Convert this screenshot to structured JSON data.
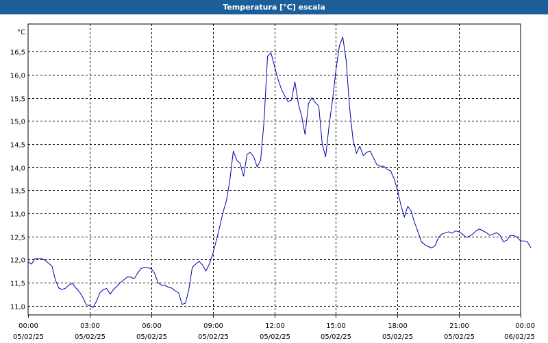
{
  "window": {
    "title": "Temperatura [°C] escala"
  },
  "chart_data": {
    "type": "line",
    "title": "Temperatura [°C] escala",
    "y_unit": "°C",
    "ylim": [
      10.8,
      17.1
    ],
    "y_ticks": [
      11.0,
      11.5,
      12.0,
      12.5,
      13.0,
      13.5,
      14.0,
      14.5,
      15.0,
      15.5,
      16.0,
      16.5
    ],
    "y_tick_labels": [
      "11,0",
      "11,5",
      "12,0",
      "12,5",
      "13,0",
      "13,5",
      "14,0",
      "14,5",
      "15,0",
      "15,5",
      "16,0",
      "16,5"
    ],
    "xlim": [
      "2025-02-05 00:00",
      "2025-02-06 00:00"
    ],
    "x_ticks": [
      {
        "time": "00:00",
        "date": "05/02/25"
      },
      {
        "time": "03:00",
        "date": "05/02/25"
      },
      {
        "time": "06:00",
        "date": "05/02/25"
      },
      {
        "time": "09:00",
        "date": "05/02/25"
      },
      {
        "time": "12:00",
        "date": "05/02/25"
      },
      {
        "time": "15:00",
        "date": "05/02/25"
      },
      {
        "time": "18:00",
        "date": "05/02/25"
      },
      {
        "time": "21:00",
        "date": "05/02/25"
      },
      {
        "time": "00:00",
        "date": "06/02/25"
      }
    ],
    "grid": true,
    "line_color": "#0000aa",
    "series": [
      {
        "points": [
          [
            "00:00",
            11.95
          ],
          [
            "00:10",
            11.9
          ],
          [
            "00:20",
            12.02
          ],
          [
            "00:40",
            12.02
          ],
          [
            "00:50",
            11.98
          ],
          [
            "01:00",
            11.92
          ],
          [
            "01:10",
            11.85
          ],
          [
            "01:20",
            11.55
          ],
          [
            "01:30",
            11.38
          ],
          [
            "01:40",
            11.35
          ],
          [
            "01:50",
            11.38
          ],
          [
            "02:00",
            11.45
          ],
          [
            "02:10",
            11.48
          ],
          [
            "02:20",
            11.38
          ],
          [
            "02:30",
            11.3
          ],
          [
            "02:40",
            11.18
          ],
          [
            "02:50",
            11.02
          ],
          [
            "03:00",
            11.0
          ],
          [
            "03:10",
            10.96
          ],
          [
            "03:20",
            11.1
          ],
          [
            "03:30",
            11.28
          ],
          [
            "03:40",
            11.35
          ],
          [
            "03:50",
            11.37
          ],
          [
            "04:00",
            11.25
          ],
          [
            "04:10",
            11.35
          ],
          [
            "04:20",
            11.42
          ],
          [
            "04:30",
            11.5
          ],
          [
            "04:40",
            11.56
          ],
          [
            "04:50",
            11.62
          ],
          [
            "05:00",
            11.62
          ],
          [
            "05:10",
            11.58
          ],
          [
            "05:20",
            11.7
          ],
          [
            "05:30",
            11.8
          ],
          [
            "05:40",
            11.83
          ],
          [
            "05:50",
            11.82
          ],
          [
            "06:00",
            11.8
          ],
          [
            "06:10",
            11.7
          ],
          [
            "06:20",
            11.5
          ],
          [
            "06:30",
            11.44
          ],
          [
            "06:40",
            11.44
          ],
          [
            "06:50",
            11.4
          ],
          [
            "07:00",
            11.38
          ],
          [
            "07:10",
            11.32
          ],
          [
            "07:20",
            11.28
          ],
          [
            "07:30",
            11.03
          ],
          [
            "07:40",
            11.05
          ],
          [
            "07:50",
            11.35
          ],
          [
            "08:00",
            11.83
          ],
          [
            "08:10",
            11.9
          ],
          [
            "08:20",
            11.96
          ],
          [
            "08:30",
            11.88
          ],
          [
            "08:40",
            11.75
          ],
          [
            "08:50",
            11.9
          ],
          [
            "09:00",
            12.12
          ],
          [
            "09:10",
            12.4
          ],
          [
            "09:20",
            12.7
          ],
          [
            "09:30",
            13.02
          ],
          [
            "09:40",
            13.28
          ],
          [
            "09:50",
            13.72
          ],
          [
            "10:00",
            14.35
          ],
          [
            "10:10",
            14.15
          ],
          [
            "10:20",
            14.08
          ],
          [
            "10:30",
            13.8
          ],
          [
            "10:40",
            14.28
          ],
          [
            "10:50",
            14.32
          ],
          [
            "11:00",
            14.22
          ],
          [
            "11:10",
            14.0
          ],
          [
            "11:20",
            14.15
          ],
          [
            "11:30",
            15.0
          ],
          [
            "11:40",
            16.4
          ],
          [
            "11:50",
            16.48
          ],
          [
            "12:00",
            16.2
          ],
          [
            "12:10",
            15.92
          ],
          [
            "12:20",
            15.7
          ],
          [
            "12:30",
            15.55
          ],
          [
            "12:40",
            15.42
          ],
          [
            "12:50",
            15.45
          ],
          [
            "13:00",
            15.85
          ],
          [
            "13:10",
            15.38
          ],
          [
            "13:20",
            15.1
          ],
          [
            "13:30",
            14.7
          ],
          [
            "13:40",
            15.38
          ],
          [
            "13:50",
            15.5
          ],
          [
            "14:00",
            15.4
          ],
          [
            "14:10",
            15.32
          ],
          [
            "14:20",
            14.5
          ],
          [
            "14:30",
            14.22
          ],
          [
            "14:40",
            14.9
          ],
          [
            "14:50",
            15.45
          ],
          [
            "15:00",
            16.1
          ],
          [
            "15:10",
            16.62
          ],
          [
            "15:20",
            16.82
          ],
          [
            "15:30",
            16.3
          ],
          [
            "15:40",
            15.3
          ],
          [
            "15:50",
            14.6
          ],
          [
            "16:00",
            14.3
          ],
          [
            "16:10",
            14.45
          ],
          [
            "16:20",
            14.25
          ],
          [
            "16:30",
            14.32
          ],
          [
            "16:40",
            14.35
          ],
          [
            "16:50",
            14.2
          ],
          [
            "17:00",
            14.05
          ],
          [
            "17:10",
            14.02
          ],
          [
            "17:20",
            14.02
          ],
          [
            "17:30",
            13.95
          ],
          [
            "17:40",
            13.92
          ],
          [
            "17:50",
            13.75
          ],
          [
            "18:00",
            13.5
          ],
          [
            "18:10",
            13.18
          ],
          [
            "18:20",
            12.92
          ],
          [
            "18:30",
            13.15
          ],
          [
            "18:40",
            13.05
          ],
          [
            "18:50",
            12.8
          ],
          [
            "19:00",
            12.6
          ],
          [
            "19:10",
            12.38
          ],
          [
            "19:20",
            12.32
          ],
          [
            "19:30",
            12.28
          ],
          [
            "19:40",
            12.25
          ],
          [
            "19:50",
            12.3
          ],
          [
            "20:00",
            12.48
          ],
          [
            "20:10",
            12.55
          ],
          [
            "20:20",
            12.58
          ],
          [
            "20:30",
            12.6
          ],
          [
            "20:40",
            12.57
          ],
          [
            "20:50",
            12.62
          ],
          [
            "21:00",
            12.6
          ],
          [
            "21:10",
            12.55
          ],
          [
            "21:20",
            12.48
          ],
          [
            "21:30",
            12.5
          ],
          [
            "21:40",
            12.55
          ],
          [
            "21:50",
            12.62
          ],
          [
            "22:00",
            12.66
          ],
          [
            "22:10",
            12.62
          ],
          [
            "22:20",
            12.58
          ],
          [
            "22:30",
            12.52
          ],
          [
            "22:40",
            12.55
          ],
          [
            "22:50",
            12.58
          ],
          [
            "23:00",
            12.52
          ],
          [
            "23:10",
            12.38
          ],
          [
            "23:20",
            12.42
          ],
          [
            "23:30",
            12.52
          ],
          [
            "23:40",
            12.52
          ],
          [
            "23:50",
            12.48
          ],
          [
            "00:00",
            12.4
          ],
          [
            "00:10",
            12.4
          ],
          [
            "00:20",
            12.38
          ],
          [
            "00:30",
            12.25
          ]
        ]
      }
    ]
  }
}
